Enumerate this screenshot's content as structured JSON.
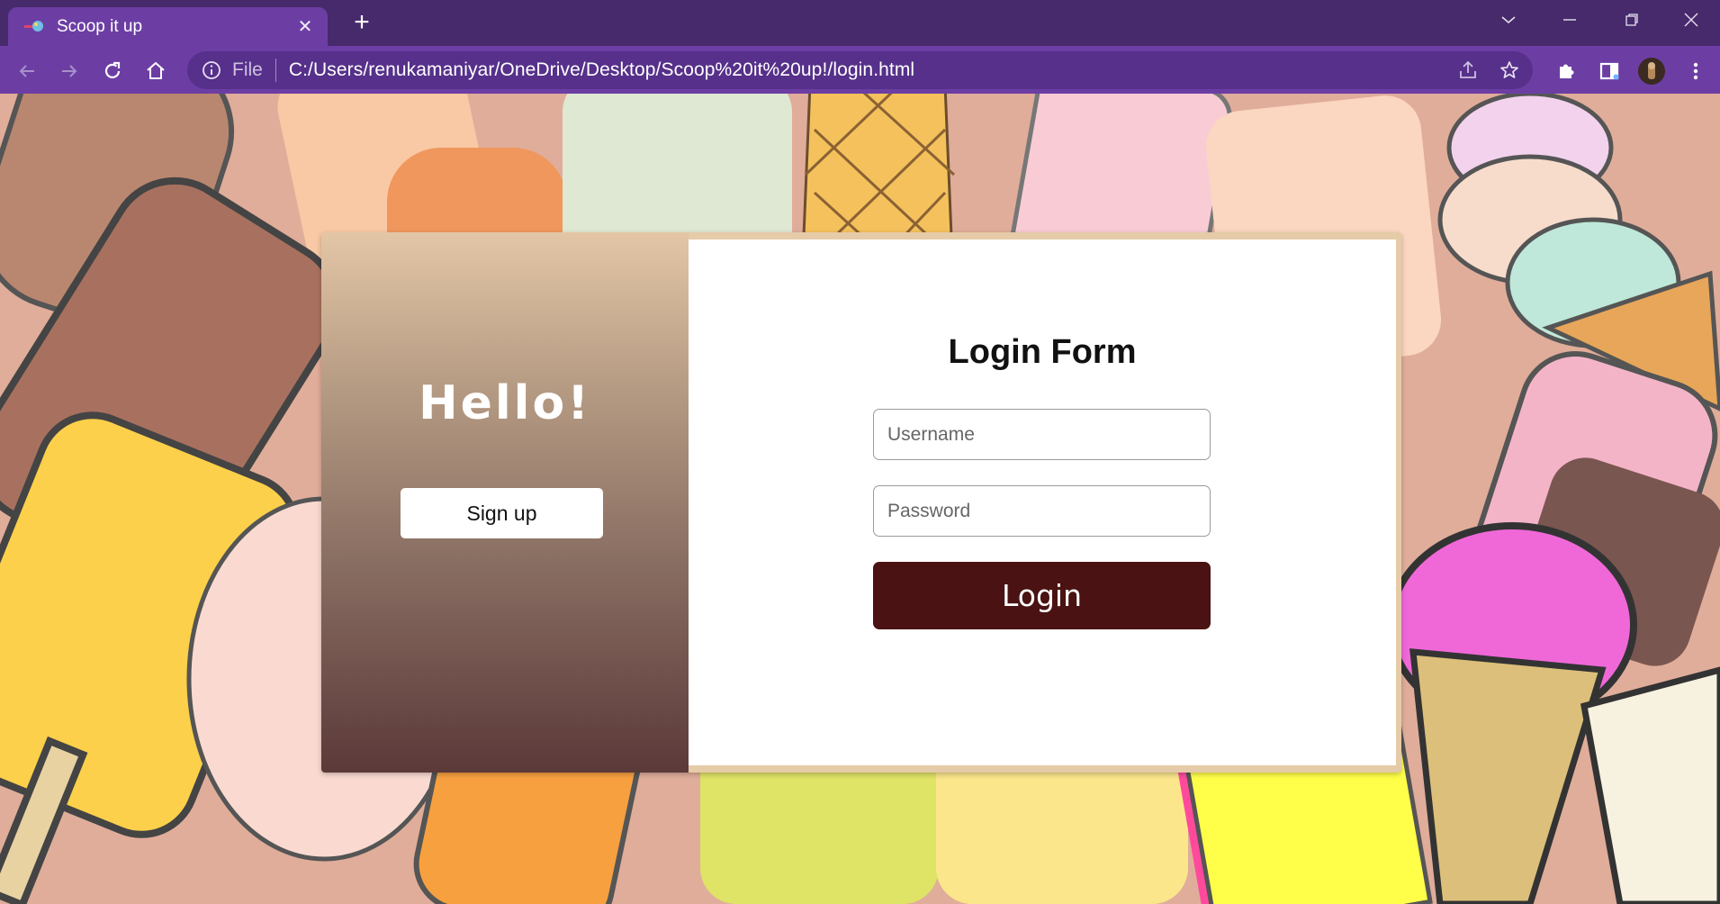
{
  "browser": {
    "tab_title": "Scoop it up",
    "tab_close_label": "✕",
    "new_tab_label": "+",
    "address_scheme": "File",
    "address_url": "C:/Users/renukamaniyar/OneDrive/Desktop/Scoop%20it%20up!/login.html",
    "accent_color": "#6c3ea4",
    "titlebar_color": "#462a6b"
  },
  "icons": {
    "back": "arrow-left-icon",
    "forward": "arrow-right-icon",
    "reload": "reload-icon",
    "home": "home-icon",
    "info": "info-icon",
    "share": "share-icon",
    "bookmark": "star-icon",
    "extensions": "puzzle-icon",
    "sidepanel": "sidepanel-icon",
    "profile": "avatar",
    "menu": "kebab-menu-icon"
  },
  "left_panel": {
    "greeting": "Hello!",
    "signup_label": "Sign up"
  },
  "login_form": {
    "title": "Login Form",
    "username_placeholder": "Username",
    "password_placeholder": "Password",
    "login_label": "Login",
    "button_color": "#4a1212"
  }
}
